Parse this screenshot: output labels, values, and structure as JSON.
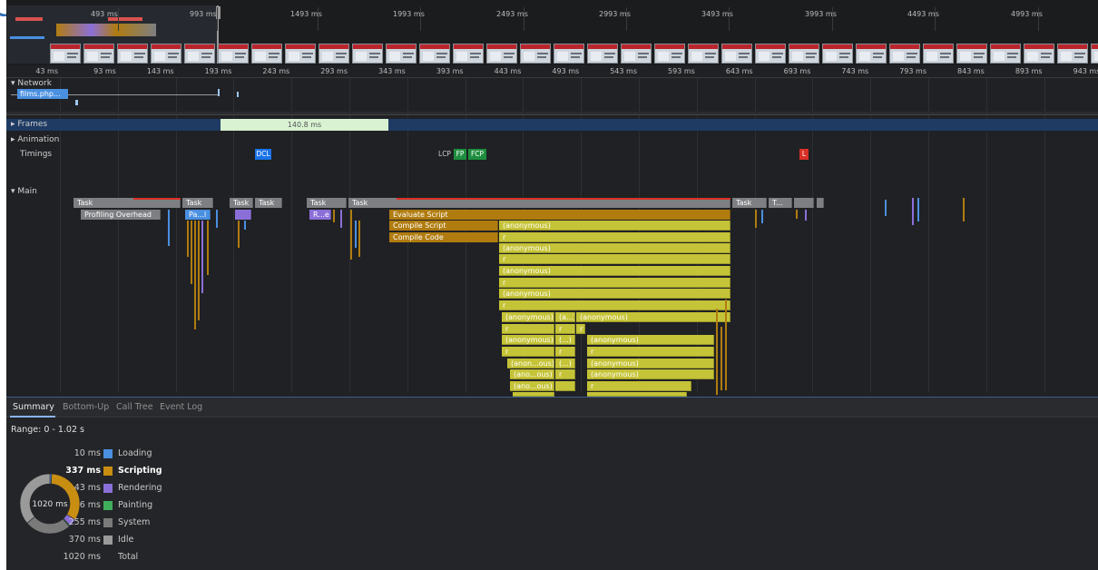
{
  "overview": {
    "ticks": [
      "493 ms",
      "993 ms",
      "1493 ms",
      "1993 ms",
      "2493 ms",
      "2993 ms",
      "3493 ms",
      "3993 ms",
      "4493 ms",
      "4993 ms"
    ]
  },
  "ruler": {
    "ticks": [
      "43 ms",
      "93 ms",
      "143 ms",
      "193 ms",
      "243 ms",
      "293 ms",
      "343 ms",
      "393 ms",
      "443 ms",
      "493 ms",
      "543 ms",
      "593 ms",
      "643 ms",
      "693 ms",
      "743 ms",
      "793 ms",
      "843 ms",
      "893 ms",
      "943 ms"
    ]
  },
  "tracks": {
    "network": {
      "label": "Network",
      "request": "films.php..."
    },
    "frames": {
      "label": "Frames",
      "frame_label": "140.8 ms"
    },
    "animation": {
      "label": "Animation"
    },
    "timings": {
      "label": "Timings",
      "markers": {
        "dcl": "DCL",
        "lcp": "LCP",
        "fp": "FP",
        "fcp": "FCP",
        "l": "L"
      }
    },
    "main": {
      "label": "Main"
    }
  },
  "flame": {
    "tasks": [
      "Task",
      "Task",
      "Task",
      "Task",
      "Task",
      "Task",
      "Task",
      "T..."
    ],
    "profiling_overhead": "Profiling Overhead",
    "pa": "Pa...l",
    "re": "R...e",
    "evaluate_script": "Evaluate Script",
    "compile_script": "Compile Script",
    "compile_code": "Compile Code",
    "anonymous": "(anonymous)",
    "r": "r",
    "a_short": "(a...)",
    "ellipsis": "(...)",
    "anon_ous": "(anon...ous)",
    "ano_ous": "(ano...ous)"
  },
  "bottom": {
    "tabs": [
      "Summary",
      "Bottom-Up",
      "Call Tree",
      "Event Log"
    ],
    "range": "Range: 0 - 1.02 s",
    "donut_total": "1020 ms",
    "legend": [
      {
        "value": "10 ms",
        "name": "Loading",
        "color": "#4a8fe0",
        "ms": 10
      },
      {
        "value": "337 ms",
        "name": "Scripting",
        "color": "#c88e12",
        "ms": 337
      },
      {
        "value": "43 ms",
        "name": "Rendering",
        "color": "#8b6fd8",
        "ms": 43
      },
      {
        "value": "6 ms",
        "name": "Painting",
        "color": "#3fae5c",
        "ms": 6
      },
      {
        "value": "255 ms",
        "name": "System",
        "color": "#7a7a7a",
        "ms": 255
      },
      {
        "value": "370 ms",
        "name": "Idle",
        "color": "#9a9a9a",
        "ms": 370
      },
      {
        "value": "1020 ms",
        "name": "Total"
      }
    ]
  }
}
